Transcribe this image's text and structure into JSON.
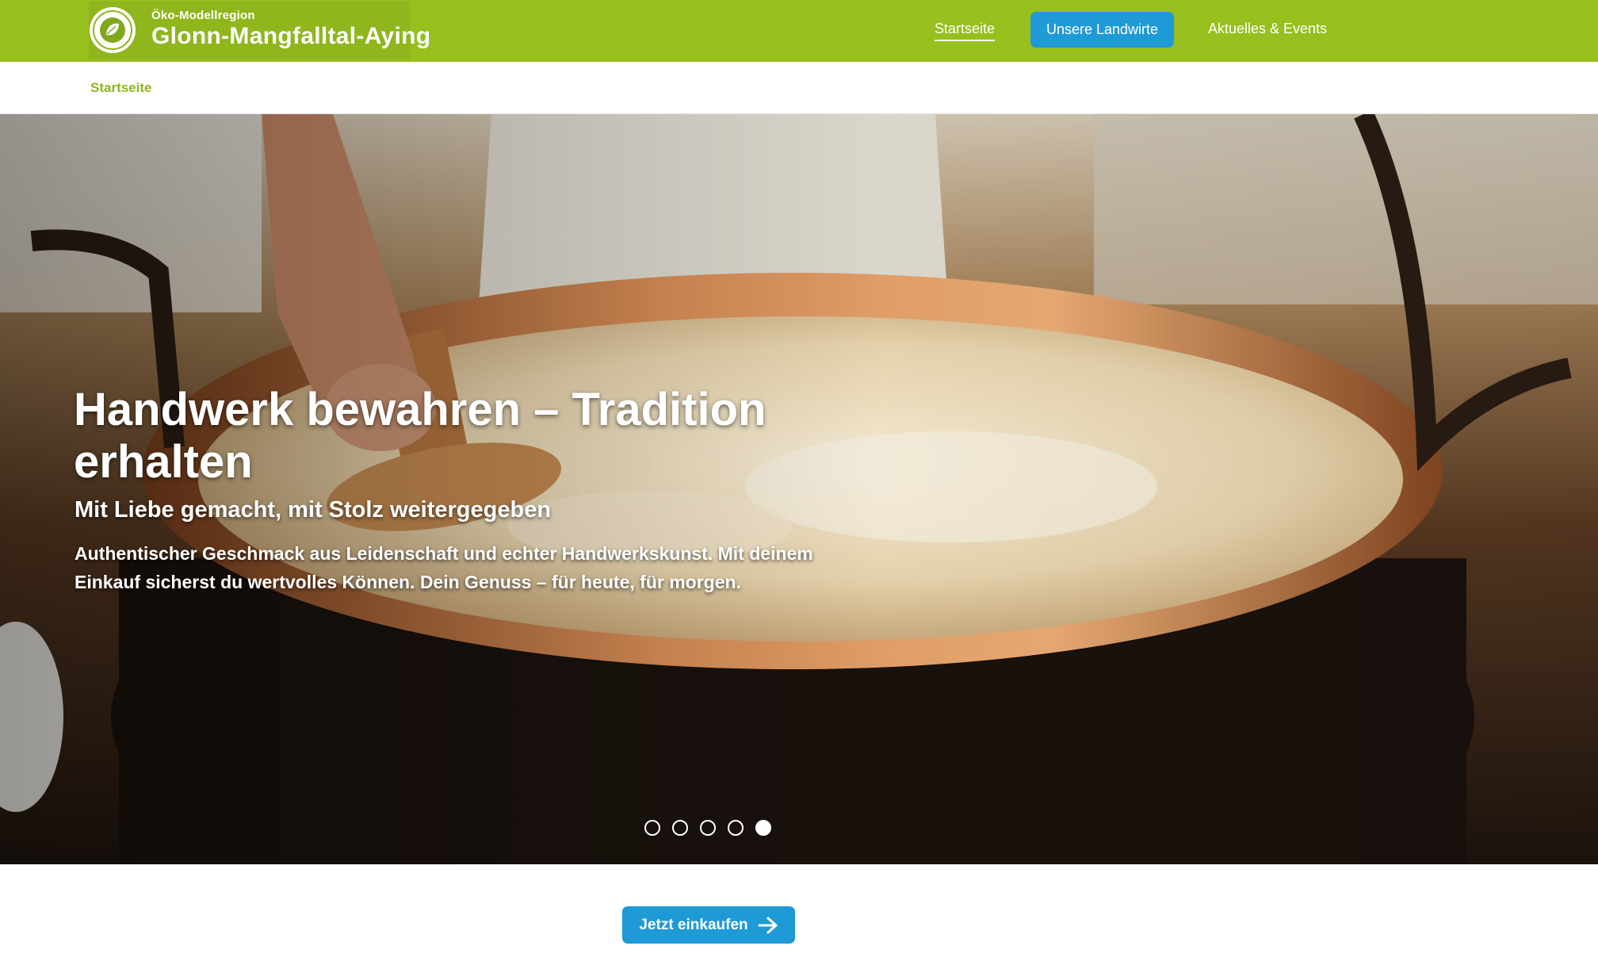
{
  "header": {
    "logo_sub": "Öko-Modellregion",
    "logo_title": "Glonn-Mangfalltal-Aying",
    "nav": [
      {
        "label": "Startseite"
      },
      {
        "label": "Unsere Landwirte"
      },
      {
        "label": "Aktuelles & Events"
      }
    ]
  },
  "breadcrumb": {
    "current": "Startseite"
  },
  "hero": {
    "title": "Handwerk bewahren – Tradition erhalten",
    "subtitle": "Mit Liebe gemacht, mit Stolz weitergegeben",
    "text": "Authentischer Geschmack aus Leidenschaft und echter Handwerkskunst. Mit deinem Einkauf sicherst du wertvolles Können. Dein Genuss – für heute, für morgen.",
    "slides_total": 5,
    "active_slide": 5
  },
  "cta": {
    "label": "Jetzt einkaufen",
    "icon": "arrow-right-icon"
  },
  "colors": {
    "header_green": "#97bf1d",
    "accent_blue": "#1e9ad6",
    "breadcrumb_green": "#8db81a"
  }
}
